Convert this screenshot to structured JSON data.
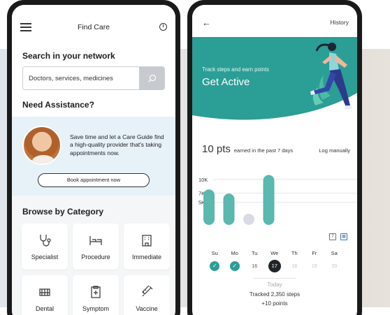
{
  "left_screen": {
    "header": {
      "title": "Find Care",
      "menu_icon": "hamburger-menu-icon",
      "info_icon": "info-icon"
    },
    "search": {
      "heading": "Search in your network",
      "placeholder": "Doctors, services, medicines",
      "button_icon": "search-icon"
    },
    "assistance": {
      "heading": "Need Assistance?",
      "description": "Save time and let a Care Guide find a high-quality provider that's taking appointments now.",
      "button_label": "Book appointment now"
    },
    "browse": {
      "heading": "Browse by Category",
      "categories": [
        {
          "label": "Specialist",
          "icon": "stethoscope-icon"
        },
        {
          "label": "Procedure",
          "icon": "hospital-bed-icon"
        },
        {
          "label": "Immediate",
          "icon": "urgent-care-icon"
        },
        {
          "label": "Dental",
          "icon": "teeth-icon"
        },
        {
          "label": "Symptom",
          "icon": "clipboard-icon"
        },
        {
          "label": "Vaccine",
          "icon": "syringe-icon"
        }
      ]
    }
  },
  "right_screen": {
    "header": {
      "back_icon": "back-arrow-icon",
      "history_label": "History"
    },
    "hero": {
      "subtitle": "Track steps and earn points",
      "title": "Get Active",
      "color": "#2b9e96",
      "illustration": "runner-illustration"
    },
    "summary": {
      "points": "10 pts",
      "points_caption": "earned in the past 7 days",
      "log_label": "Log manually"
    },
    "chart_data": {
      "type": "bar",
      "categories": [
        "Su",
        "Mo",
        "Tu",
        "We",
        "Th",
        "Fr",
        "Sa"
      ],
      "values": [
        7800,
        6900,
        1500,
        11000,
        null,
        null,
        null
      ],
      "y_ticks": [
        "10K",
        "7K",
        "5K"
      ],
      "y_tick_values": [
        10000,
        7000,
        5000
      ],
      "ylim": [
        0,
        12000
      ],
      "grid": true,
      "colors": {
        "active": "#5ab8ae",
        "inactive": "#d8dbe3"
      }
    },
    "days": [
      {
        "label": "Su",
        "mark": "check"
      },
      {
        "label": "Mo",
        "mark": "check"
      },
      {
        "label": "Tu",
        "mark": "16"
      },
      {
        "label": "We",
        "mark": "17",
        "today": true
      },
      {
        "label": "Th",
        "mark": "18",
        "future": true
      },
      {
        "label": "Fr",
        "mark": "19",
        "future": true
      },
      {
        "label": "Sa",
        "mark": "20",
        "future": true
      }
    ],
    "calendar_icons": [
      "week-calendar-icon",
      "month-calendar-icon"
    ],
    "today": {
      "label": "Today",
      "tracked": "Tracked 2,350 steps",
      "points": "+10 points"
    }
  }
}
